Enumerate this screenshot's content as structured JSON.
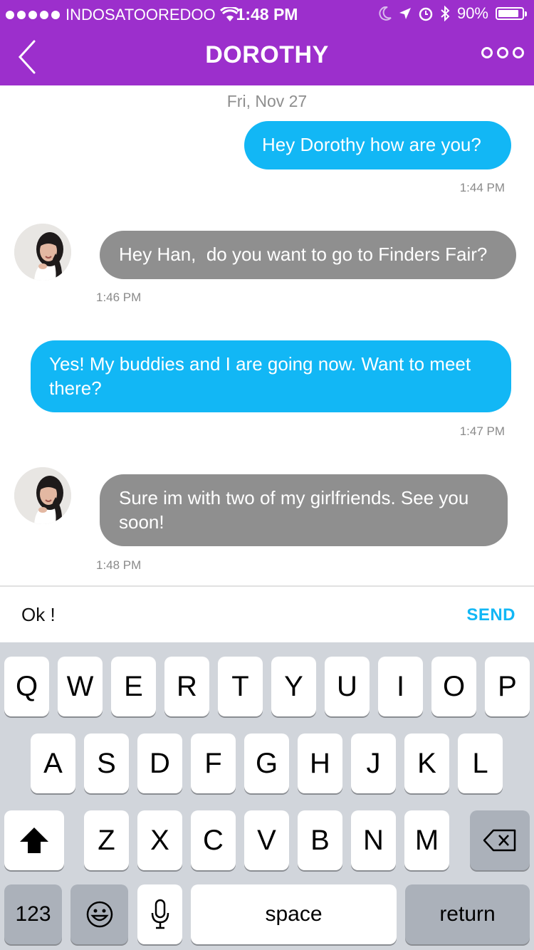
{
  "status_bar": {
    "carrier": "INDOSATOOREDOO",
    "time": "1:48 PM",
    "battery": "90%",
    "icons": [
      "signal-dots-icon",
      "wifi-icon",
      "moon-icon",
      "location-arrow-icon",
      "alarm-icon",
      "bluetooth-icon",
      "battery-icon"
    ]
  },
  "nav": {
    "title": "DOROTHY",
    "back_icon": "chevron-left-icon",
    "more_icon": "more-dots-icon"
  },
  "colors": {
    "header": "#9c2fcc",
    "outgoing_bubble": "#12b7f5",
    "incoming_bubble": "#8f8f8f",
    "send": "#12b7f5",
    "keyboard_bg": "#d1d5db"
  },
  "chat": {
    "date": "Fri, Nov 27",
    "messages": [
      {
        "direction": "out",
        "text": "Hey Dorothy how are you?",
        "time": "1:44 PM"
      },
      {
        "direction": "in",
        "text": "Hey Han,  do you want to go to Finders Fair?",
        "time": "1:46 PM"
      },
      {
        "direction": "out",
        "text": "Yes! My buddies and I are going now. Want to meet there?",
        "time": "1:47 PM"
      },
      {
        "direction": "in",
        "text": "Sure im with two of my girlfriends. See you soon!",
        "time": "1:48 PM"
      }
    ]
  },
  "composer": {
    "value": "Ok !",
    "send_label": "SEND"
  },
  "keyboard": {
    "row1": [
      "Q",
      "W",
      "E",
      "R",
      "T",
      "Y",
      "U",
      "I",
      "O",
      "P"
    ],
    "row2": [
      "A",
      "S",
      "D",
      "F",
      "G",
      "H",
      "J",
      "K",
      "L"
    ],
    "row3": [
      "Z",
      "X",
      "C",
      "V",
      "B",
      "N",
      "M"
    ],
    "numbers_label": "123",
    "space_label": "space",
    "return_label": "return",
    "shift_icon": "shift-arrow-icon",
    "delete_icon": "backspace-icon",
    "emoji_icon": "emoji-icon",
    "mic_icon": "microphone-icon"
  }
}
